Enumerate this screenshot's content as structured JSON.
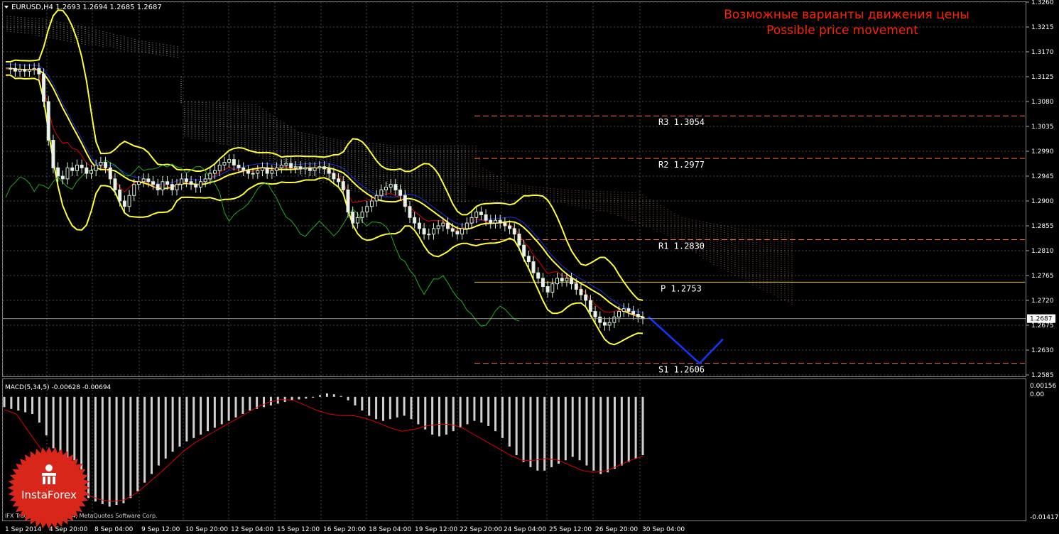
{
  "header": {
    "symbol_info": "EURUSD,H4  1.2693 1.2694 1.2685 1.2687",
    "title_ru": "Возможные варианты движения цены",
    "title_en": "Possible price movement"
  },
  "macd": {
    "label": "MACD(5,34,5) -0.00628 -0.00694",
    "scale_top": "0.00156",
    "scale_zero": "0.00",
    "scale_bottom": "-0.01417"
  },
  "footer": {
    "copyright": "IFX Trader, © 2001-2014, MetaQuotes Software Corp."
  },
  "logo": {
    "text": "InstaForex"
  },
  "colors": {
    "background": "#000000",
    "grid": "#4a4a4a",
    "bull_candle": "#d8f0d8",
    "bear_candle": "#f0f0f0",
    "bollinger": "#ffff33",
    "tenkan": "#e00000",
    "kijun": "#1f2fd8",
    "chikou": "#22aa22",
    "cloud_a": "#f2f2f2",
    "cloud_b": "#d89080",
    "pivot_lines": "#ff6a3a",
    "pivot_main": "#e6c040",
    "forecast": "#1038ff",
    "macd_hist": "#d0d0d0",
    "macd_signal": "#e00000",
    "title": "#ff2200",
    "logo": "#d8261a"
  },
  "chart_data": {
    "type": "candlestick",
    "symbol": "EURUSD",
    "timeframe": "H4",
    "ylim": [
      1.2585,
      1.326
    ],
    "y_ticks": [
      "1.3260",
      "1.3215",
      "1.3170",
      "1.3125",
      "1.3080",
      "1.3035",
      "1.2990",
      "1.2945",
      "1.2900",
      "1.2855",
      "1.2810",
      "1.2765",
      "1.2720",
      "1.2675",
      "1.2630",
      "1.2585"
    ],
    "current_price": "1.2687",
    "x_ticks": [
      "1 Sep 2014",
      "4 Sep 20:00",
      "8 Sep 04:00",
      "9 Sep 12:00",
      "10 Sep 20:00",
      "12 Sep 04:00",
      "15 Sep 12:00",
      "16 Sep 20:00",
      "18 Sep 04:00",
      "19 Sep 12:00",
      "22 Sep 20:00",
      "24 Sep 04:00",
      "25 Sep 12:00",
      "26 Sep 20:00",
      "30 Sep 04:00"
    ],
    "pivot_levels": [
      {
        "label": "R3",
        "value": "1.3054"
      },
      {
        "label": "R2",
        "value": "1.2977"
      },
      {
        "label": "R1",
        "value": "1.2830"
      },
      {
        "label": "P",
        "value": "1.2753"
      },
      {
        "label": "S1",
        "value": "1.2606"
      }
    ],
    "forecast_path": [
      1.269,
      1.2606,
      1.265
    ],
    "close_path": [
      1.314,
      1.314,
      1.3135,
      1.3138,
      1.3135,
      1.3138,
      1.314,
      1.313,
      1.308,
      1.301,
      1.296,
      1.2945,
      1.294,
      1.296,
      1.2955,
      1.2965,
      1.296,
      1.295,
      1.2955,
      1.2965,
      1.297,
      1.296,
      1.294,
      1.292,
      1.29,
      1.289,
      1.291,
      1.293,
      1.2935,
      1.294,
      1.2935,
      1.293,
      1.292,
      1.2935,
      1.293,
      1.292,
      1.293,
      1.294,
      1.2935,
      1.293,
      1.2925,
      1.2935,
      1.294,
      1.295,
      1.2955,
      1.2965,
      1.297,
      1.2975,
      1.2965,
      1.296,
      1.2955,
      1.295,
      1.295,
      1.2955,
      1.296,
      1.295,
      1.2955,
      1.296,
      1.2965,
      1.2968,
      1.296,
      1.2962,
      1.2958,
      1.296,
      1.2955,
      1.296,
      1.2962,
      1.2958,
      1.295,
      1.294,
      1.2935,
      1.292,
      1.288,
      1.286,
      1.287,
      1.288,
      1.289,
      1.29,
      1.291,
      1.292,
      1.2925,
      1.293,
      1.292,
      1.291,
      1.289,
      1.287,
      1.286,
      1.285,
      1.284,
      1.284,
      1.285,
      1.2855,
      1.286,
      1.285,
      1.2845,
      1.284,
      1.285,
      1.286,
      1.287,
      1.288,
      1.2875,
      1.2865,
      1.286,
      1.2865,
      1.286,
      1.2855,
      1.285,
      1.284,
      1.282,
      1.28,
      1.279,
      1.277,
      1.276,
      1.2745,
      1.2735,
      1.275,
      1.276,
      1.2755,
      1.276,
      1.275,
      1.274,
      1.273,
      1.272,
      1.27,
      1.269,
      1.268,
      1.2675,
      1.268,
      1.269,
      1.27,
      1.2705,
      1.27,
      1.2695,
      1.269,
      1.2687
    ],
    "macd_hist_path": [
      -0.0012,
      -0.0014,
      -0.0016,
      -0.0018,
      -0.002,
      -0.003,
      -0.0045,
      -0.006,
      -0.0075,
      -0.009,
      -0.01,
      -0.011,
      -0.0118,
      -0.0122,
      -0.0125,
      -0.0128,
      -0.0126,
      -0.0124,
      -0.0118,
      -0.011,
      -0.01,
      -0.009,
      -0.008,
      -0.0072,
      -0.0064,
      -0.0058,
      -0.0052,
      -0.0048,
      -0.0044,
      -0.004,
      -0.0036,
      -0.0032,
      -0.0028,
      -0.0024,
      -0.002,
      -0.0016,
      -0.0014,
      -0.0012,
      -0.001,
      -0.0008,
      -0.0006,
      -0.0004,
      -0.0003,
      -0.0002,
      -0.0001,
      0.0002,
      0.0004,
      0.0003,
      0.0001,
      -0.0004,
      -0.001,
      -0.0016,
      -0.0022,
      -0.0026,
      -0.0028,
      -0.0026,
      -0.0024,
      -0.0022,
      -0.0026,
      -0.0032,
      -0.0038,
      -0.0044,
      -0.0046,
      -0.0044,
      -0.004,
      -0.0036,
      -0.0032,
      -0.0028,
      -0.003,
      -0.0034,
      -0.004,
      -0.0048,
      -0.0058,
      -0.0068,
      -0.0076,
      -0.0082,
      -0.0086,
      -0.0086,
      -0.0082,
      -0.0078,
      -0.0074,
      -0.007,
      -0.0074,
      -0.008,
      -0.0086,
      -0.009,
      -0.0088,
      -0.0084,
      -0.008,
      -0.0076,
      -0.0072,
      -0.0068
    ],
    "macd_signal_path": [
      -0.0015,
      -0.002,
      -0.004,
      -0.006,
      -0.008,
      -0.0095,
      -0.0105,
      -0.0115,
      -0.012,
      -0.0122,
      -0.012,
      -0.0112,
      -0.01,
      -0.0088,
      -0.0075,
      -0.0062,
      -0.0052,
      -0.0044,
      -0.0036,
      -0.0028,
      -0.002,
      -0.0012,
      -0.0006,
      -0.0003,
      -0.0004,
      -0.001,
      -0.0016,
      -0.002,
      -0.0022,
      -0.0022,
      -0.0025,
      -0.003,
      -0.0036,
      -0.004,
      -0.0038,
      -0.0034,
      -0.0032,
      -0.0032,
      -0.0036,
      -0.0044,
      -0.0052,
      -0.006,
      -0.0068,
      -0.0074,
      -0.0074,
      -0.0072,
      -0.0074,
      -0.008,
      -0.0086,
      -0.0088,
      -0.0086,
      -0.008,
      -0.0074,
      -0.0069
    ]
  }
}
